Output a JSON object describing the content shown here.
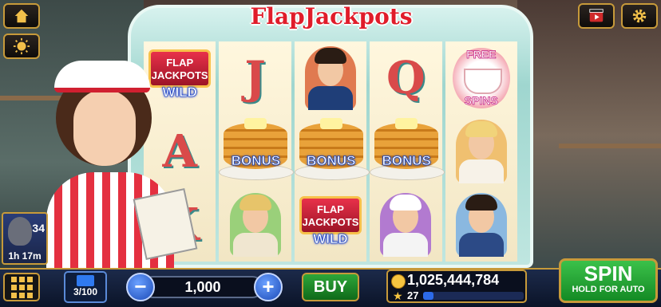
{
  "game": {
    "title": "FlapJackpots",
    "colors": {
      "accent_gold": "#c79a3a",
      "spin_green": "#2ea63a",
      "title_red": "#e01c2a"
    }
  },
  "top_buttons": {
    "home": "home-icon",
    "daily_bonus": "sun-icon",
    "video": "video-icon",
    "settings": "gear-icon"
  },
  "reels": [
    [
      {
        "type": "wild",
        "plate": "FLAP JACKPOTS",
        "label": "WILD"
      },
      {
        "type": "letter",
        "value": "A"
      },
      {
        "type": "letter",
        "value": "K"
      }
    ],
    [
      {
        "type": "letter",
        "value": "J"
      },
      {
        "type": "bonus",
        "label": "BONUS"
      },
      {
        "type": "char",
        "name": "boy"
      }
    ],
    [
      {
        "type": "char",
        "name": "man-suit"
      },
      {
        "type": "bonus",
        "label": "BONUS"
      },
      {
        "type": "wild",
        "plate": "FLAP JACKPOTS",
        "label": "WILD"
      }
    ],
    [
      {
        "type": "letter",
        "value": "Q"
      },
      {
        "type": "bonus",
        "label": "BONUS"
      },
      {
        "type": "char",
        "name": "chef"
      }
    ],
    [
      {
        "type": "free",
        "line1": "FREE",
        "line2": "SPINS"
      },
      {
        "type": "char",
        "name": "blonde-woman"
      },
      {
        "type": "char",
        "name": "man-coffee"
      }
    ]
  ],
  "player": {
    "level": "34",
    "timer": "1h 17m"
  },
  "bottom": {
    "lines": "3/100",
    "bet": "1,000",
    "minus": "−",
    "plus": "+",
    "buy": "BUY",
    "balance": "1,025,444,784",
    "xp_level": "27",
    "xp_progress": 0.1,
    "spin": "SPIN",
    "spin_sub": "HOLD FOR AUTO"
  }
}
